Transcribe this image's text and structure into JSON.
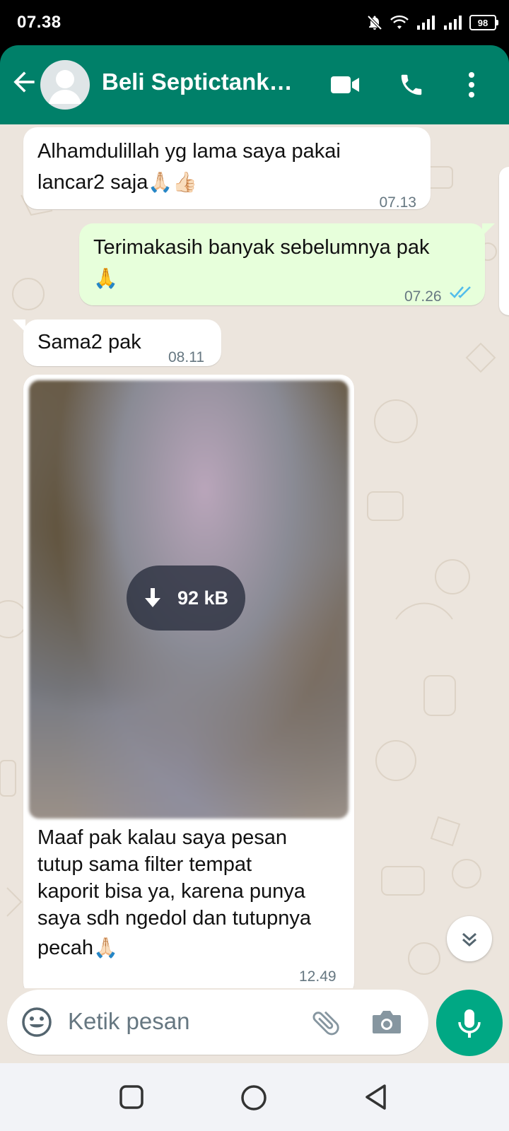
{
  "status_bar": {
    "time": "07.38",
    "battery": "98"
  },
  "header": {
    "title": "Beli Septictank…"
  },
  "messages": [
    {
      "type": "in",
      "line1": "Alhamdulillah yg lama saya pakai",
      "line2": "lancar2 saja",
      "emoji": "🙏🏻👍🏻",
      "time": "07.13"
    },
    {
      "type": "out",
      "line1": "Terimakasih banyak sebelumnya pak",
      "emoji": "🙏",
      "time": "07.26"
    },
    {
      "type": "in",
      "text": "Sama2 pak",
      "time": "08.11"
    },
    {
      "type": "in-image",
      "download_size": "92 kB",
      "caption_lines": [
        "Maaf pak kalau saya pesan",
        "tutup sama filter tempat",
        "kaporit bisa ya, karena punya",
        "saya sdh ngedol dan tutupnya"
      ],
      "caption_last": "pecah",
      "emoji": "🙏🏻",
      "time": "12.49"
    }
  ],
  "composer": {
    "placeholder": "Ketik pesan"
  },
  "colors": {
    "header": "#008069",
    "accent": "#00a884",
    "outgoing_bubble": "#e7ffdb",
    "chat_bg": "#ece5dd",
    "read_ticks": "#53bdeb"
  },
  "icons": [
    "back-arrow-icon",
    "avatar-icon",
    "video-call-icon",
    "phone-icon",
    "more-vert-icon",
    "emoji-icon",
    "attach-icon",
    "camera-icon",
    "mic-icon",
    "scroll-down-icon",
    "double-check-icon",
    "download-icon"
  ]
}
